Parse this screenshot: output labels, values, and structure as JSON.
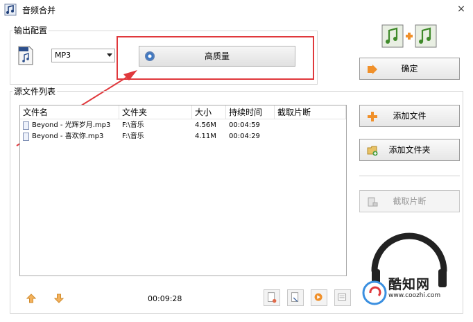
{
  "window": {
    "title": "音频合并",
    "close_glyph": "×"
  },
  "output": {
    "group_label": "输出配置",
    "format_selected": "MP3",
    "quality_button_label": "高质量"
  },
  "buttons": {
    "confirm": "确定",
    "add_file": "添加文件",
    "add_folder": "添加文件夹",
    "clip": "截取片断"
  },
  "source_list": {
    "group_label": "源文件列表",
    "columns": [
      "文件名",
      "文件夹",
      "大小",
      "持续时间",
      "截取片断"
    ],
    "rows": [
      {
        "name": "Beyond - 光辉岁月.mp3",
        "folder": "F:\\音乐",
        "size": "4.56M",
        "duration": "00:04:59",
        "clip": ""
      },
      {
        "name": "Beyond - 喜欢你.mp3",
        "folder": "F:\\音乐",
        "size": "4.11M",
        "duration": "00:04:29",
        "clip": ""
      }
    ],
    "total_duration": "00:09:28"
  },
  "watermark": {
    "brand": "酷知网",
    "url": "www.coozhi.com"
  },
  "colors": {
    "annotation_red": "#e0383c",
    "accent_orange": "#f0902a"
  }
}
